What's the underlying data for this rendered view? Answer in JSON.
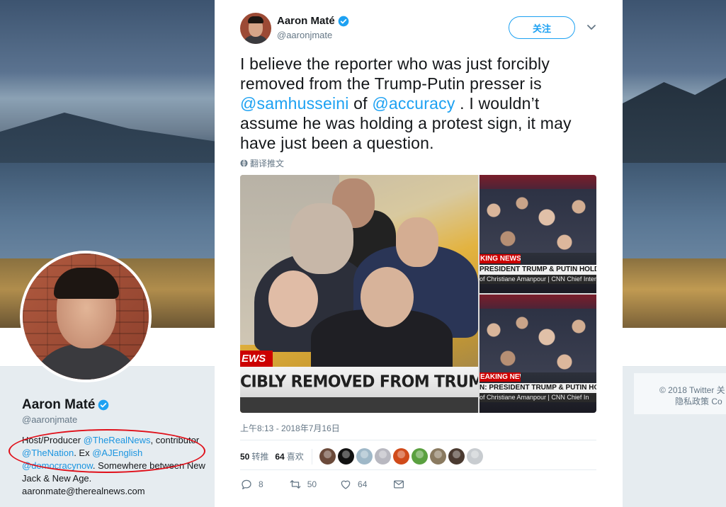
{
  "background_profile": {
    "name": "Aaron Maté",
    "handle": "@aaronjmate",
    "bio": {
      "t1": "Host/Producer ",
      "m1": "@TheRealNews",
      "t2": ", contributor",
      "m2": "@TheNation",
      "t3": ". Ex ",
      "m3": "@AJEnglish",
      "m4": "@democracynow",
      "t4": ". Somewhere between New Jack & New Age."
    },
    "email": "aaronmate@therealnews.com"
  },
  "right_footer": {
    "line1": "© 2018 Twitter  关",
    "line2": "隐私政策   Co"
  },
  "tweet": {
    "author_name": "Aaron Maté",
    "author_handle": "@aaronjmate",
    "follow_label": "关注",
    "text": {
      "t1": "I believe the reporter who was just forcibly removed from the Trump-Putin presser is ",
      "mention1": "@samhusseini",
      "t2": " of ",
      "mention2": "@accuracy",
      "t3": " . I wouldn’t assume he was holding a protest sign, it may have just been a question."
    },
    "translate_label": "翻译推文",
    "media": {
      "main_tag": "EWS",
      "main_lower_third": "CIBLY REMOVED FROM TRUMP-PUTIN BR",
      "side_top_breaking": "KING NEWS",
      "side_top_strap": "PRESIDENT TRUMP & PUTIN HOLD PR",
      "side_top_sub": "of Christiane Amanpour | CNN Chief Inter",
      "side_btm_breaking": "EAKING NEWS",
      "side_btm_strap": "N: PRESIDENT TRUMP & PUTIN HOLD I",
      "side_btm_sub": "of Christiane Amanpour | CNN Chief In"
    },
    "timestamp": "上午8:13 - 2018年7月16日",
    "retweets_count": "50",
    "retweets_label": "转推",
    "likes_count": "64",
    "likes_label": "喜欢",
    "liker_colors": [
      "#6b4a3a",
      "#111111",
      "#9fb8c8",
      "#b8b8c0",
      "#d04a1a",
      "#5aa040",
      "#8a7a60",
      "#4a3a30",
      "#c8ccd0"
    ],
    "actions": {
      "reply_count": "8",
      "retweet_count": "50",
      "like_count": "64"
    }
  },
  "colors": {
    "accent": "#1da1f2",
    "annotation_circle": "#e0101a"
  }
}
